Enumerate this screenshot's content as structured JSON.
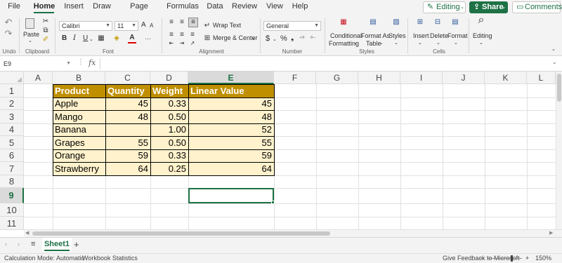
{
  "tabs": [
    "File",
    "Home",
    "Insert",
    "Draw",
    "Page Layout",
    "Formulas",
    "Data",
    "Review",
    "View",
    "Help"
  ],
  "active_tab": "Home",
  "top_buttons": {
    "editing": "Editing",
    "share": "Share",
    "comments": "Comments"
  },
  "ribbon": {
    "undo": {
      "label": "Undo"
    },
    "clipboard": {
      "paste": "Paste",
      "label": "Clipboard"
    },
    "font": {
      "family": "Calibri",
      "size": "11",
      "bold": "B",
      "italic": "I",
      "underline": "U",
      "grow": "A",
      "shrink": "A",
      "label": "Font"
    },
    "alignment": {
      "wrap_text": "Wrap Text",
      "merge_center": "Merge & Center",
      "label": "Alignment"
    },
    "number": {
      "format": "General",
      "currency": "$",
      "percent": "%",
      "label": "Number"
    },
    "styles": {
      "conditional": "Conditional",
      "formatting": "Formatting",
      "format_as": "Format As",
      "table": "Table",
      "styles": "Styles",
      "label": "Styles"
    },
    "cells": {
      "insert": "Insert",
      "delete": "Delete",
      "format": "Format",
      "label": "Cells"
    },
    "editing": {
      "label": "Editing"
    }
  },
  "formula_bar": {
    "name_box": "E9",
    "fx": "fx",
    "formula": ""
  },
  "columns": [
    "A",
    "B",
    "C",
    "D",
    "E",
    "F",
    "G",
    "H",
    "I",
    "J",
    "K",
    "L"
  ],
  "selected_column": "E",
  "rows": [
    "1",
    "2",
    "3",
    "4",
    "5",
    "6",
    "7",
    "8",
    "9",
    "10",
    "11"
  ],
  "selected_row": "9",
  "table": {
    "headers": [
      "Product",
      "Quantity",
      "Weight",
      "Linear Value"
    ],
    "rows": [
      [
        "Apple",
        "45",
        "0.33",
        "45"
      ],
      [
        "Mango",
        "48",
        "0.50",
        "48"
      ],
      [
        "Banana",
        "",
        "1.00",
        "52"
      ],
      [
        "Grapes",
        "55",
        "0.50",
        "55"
      ],
      [
        "Orange",
        "59",
        "0.33",
        "59"
      ],
      [
        "Strawberry",
        "64",
        "0.25",
        "64"
      ]
    ]
  },
  "sheets": {
    "active": "Sheet1",
    "add": "+"
  },
  "status": {
    "calc_mode": "Calculation Mode: Automatic",
    "workbook_stats": "Workbook Statistics",
    "feedback": "Give Feedback to Microsoft",
    "zoom_minus": "−",
    "zoom_plus": "+",
    "zoom": "150%"
  },
  "colors": {
    "accent": "#1e7145",
    "table_header": "#bf8f00",
    "table_row": "#fff2cc"
  }
}
